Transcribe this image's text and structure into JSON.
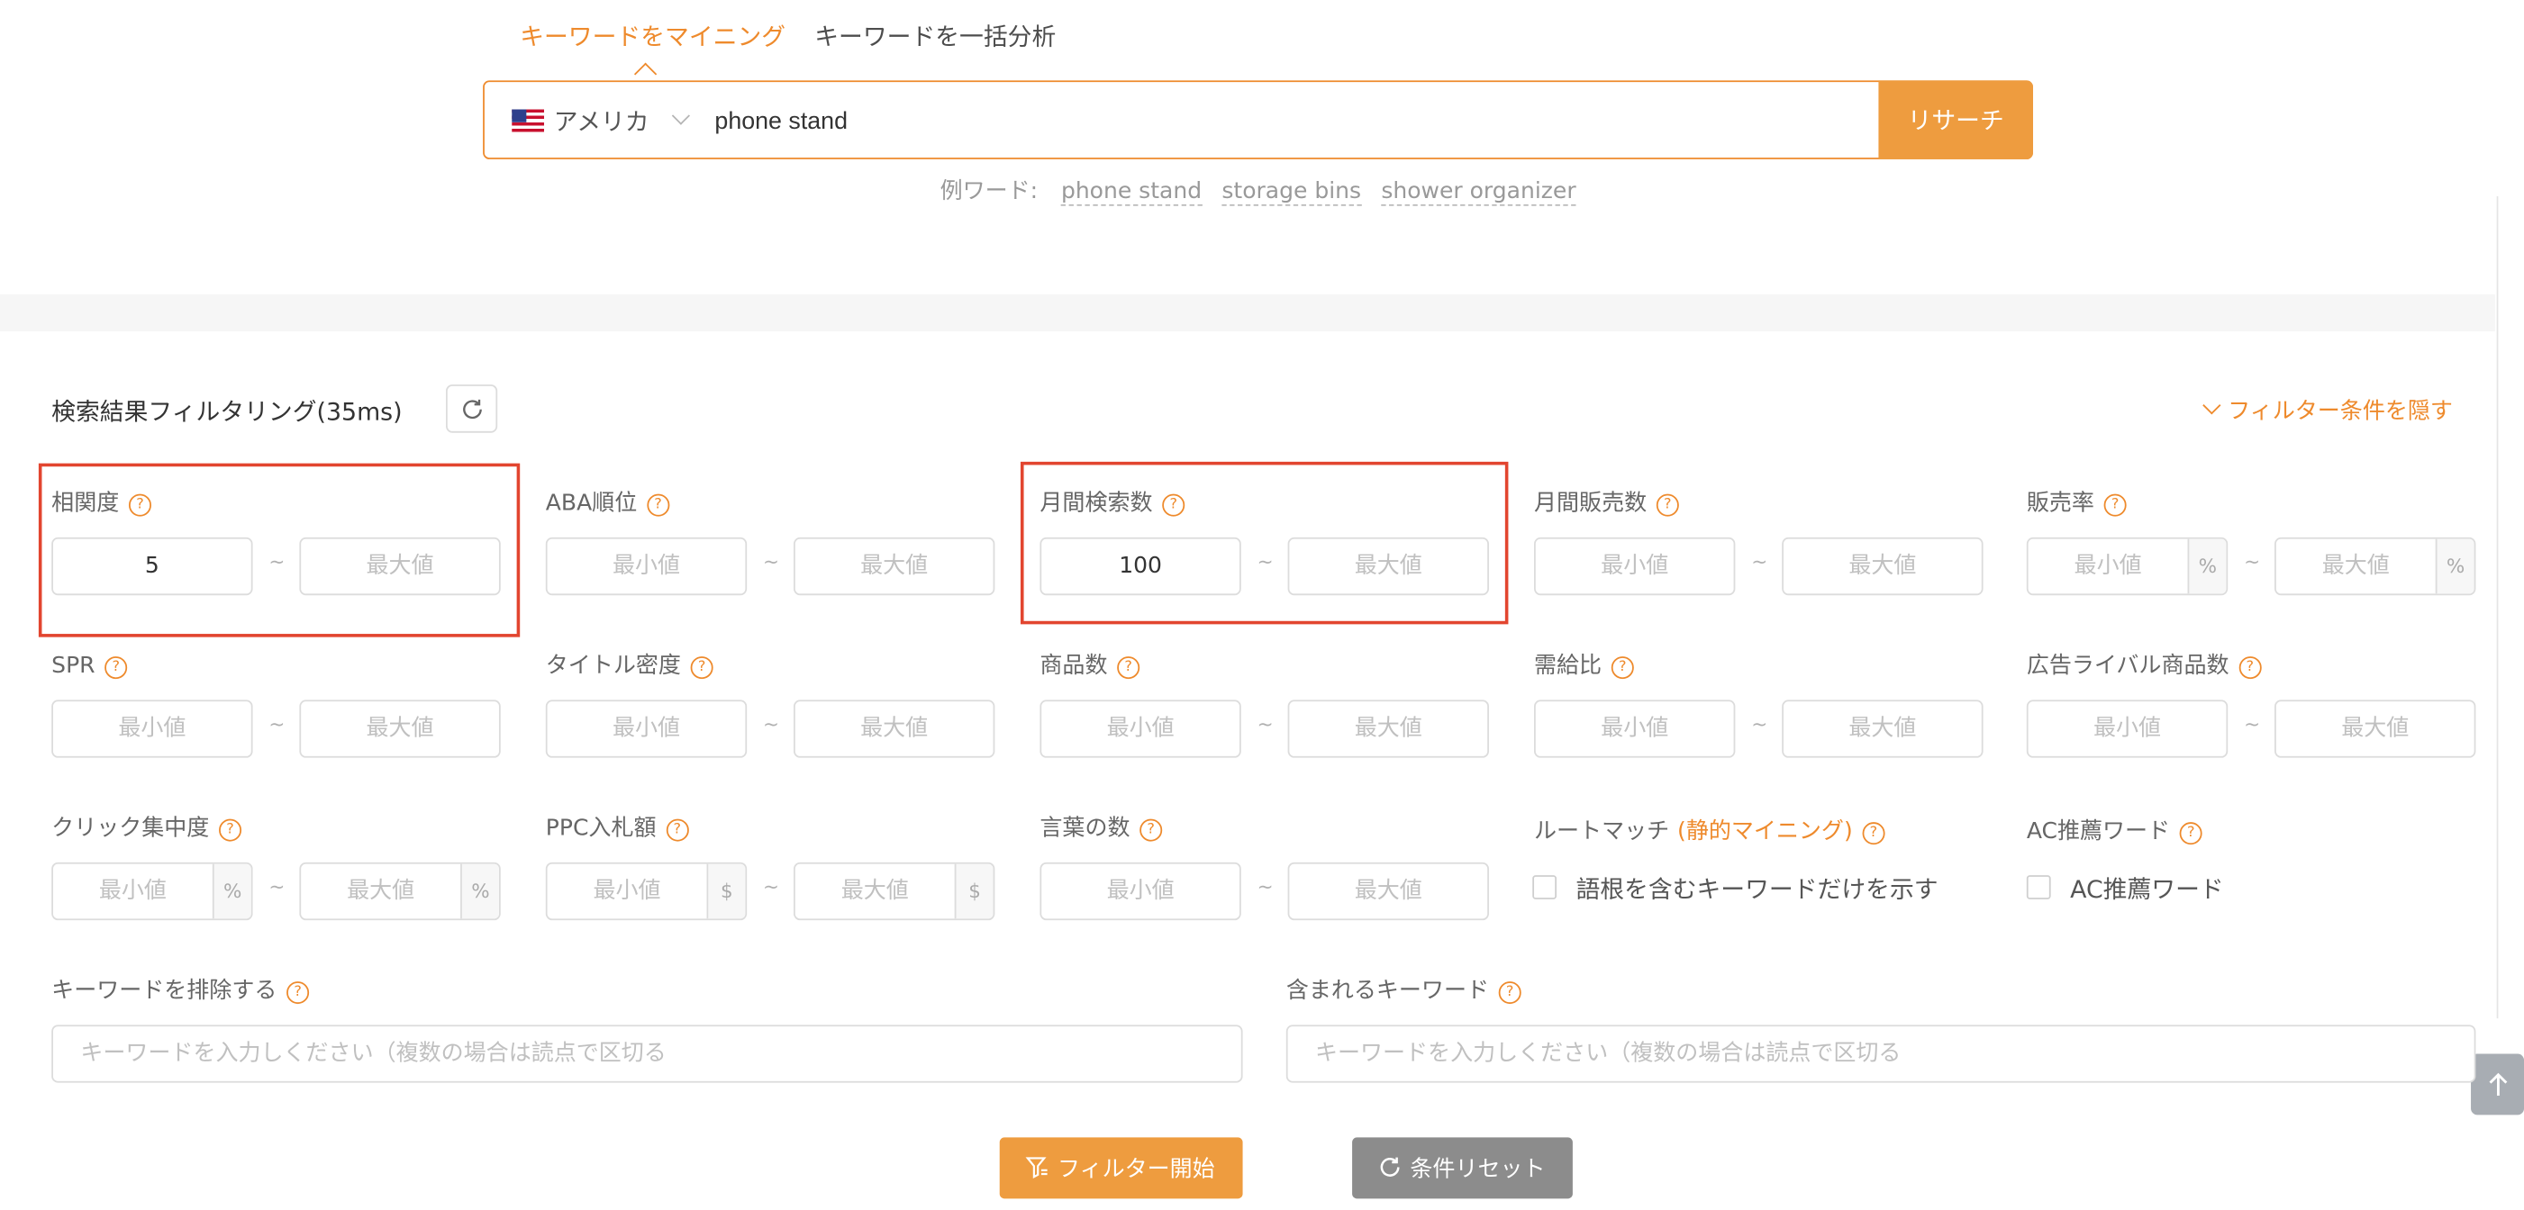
{
  "tabs": {
    "mining": "キーワードをマイニング",
    "batch": "キーワードを一括分析"
  },
  "search": {
    "country": "アメリカ",
    "query": "phone stand",
    "button": "リサーチ"
  },
  "examples": {
    "label": "例ワード:",
    "items": [
      "phone stand",
      "storage bins",
      "shower organizer"
    ]
  },
  "filter": {
    "title": "検索結果フィルタリング(35ms)",
    "hide": "フィルター条件を隠す",
    "help_glyph": "?",
    "tilde": "~",
    "min_ph": "最小値",
    "max_ph": "最大値",
    "fields": {
      "relevance": {
        "label": "相関度",
        "min": "5"
      },
      "aba": {
        "label": "ABA順位"
      },
      "monthly_search": {
        "label": "月間検索数",
        "min": "100"
      },
      "monthly_sales": {
        "label": "月間販売数"
      },
      "sales_rate": {
        "label": "販売率",
        "unit": "%"
      },
      "spr": {
        "label": "SPR"
      },
      "title_density": {
        "label": "タイトル密度"
      },
      "products": {
        "label": "商品数"
      },
      "supply_demand": {
        "label": "需給比"
      },
      "ad_rivals": {
        "label": "広告ライバル商品数"
      },
      "click_share": {
        "label": "クリック集中度",
        "unit": "%"
      },
      "ppc_bid": {
        "label": "PPC入札額",
        "unit": "$"
      },
      "word_count": {
        "label": "言葉の数"
      },
      "root_match": {
        "label": "ルートマッチ",
        "label_em": "(静的マイニング)",
        "checkbox": "語根を含むキーワードだけを示す"
      },
      "ac_words": {
        "label": "AC推薦ワード",
        "checkbox": "AC推薦ワード"
      },
      "exclude": {
        "label": "キーワードを排除する",
        "placeholder": "キーワードを入力しください（複数の場合は読点で区切る"
      },
      "include": {
        "label": "含まれるキーワード",
        "placeholder": "キーワードを入力しください（複数の場合は読点で区切る"
      }
    },
    "start_button": "フィルター開始",
    "reset_button": "条件リセット"
  },
  "colors": {
    "accent": "#ee8a2c",
    "highlight": "#e2452f",
    "reset_button": "#8c8c8c"
  }
}
